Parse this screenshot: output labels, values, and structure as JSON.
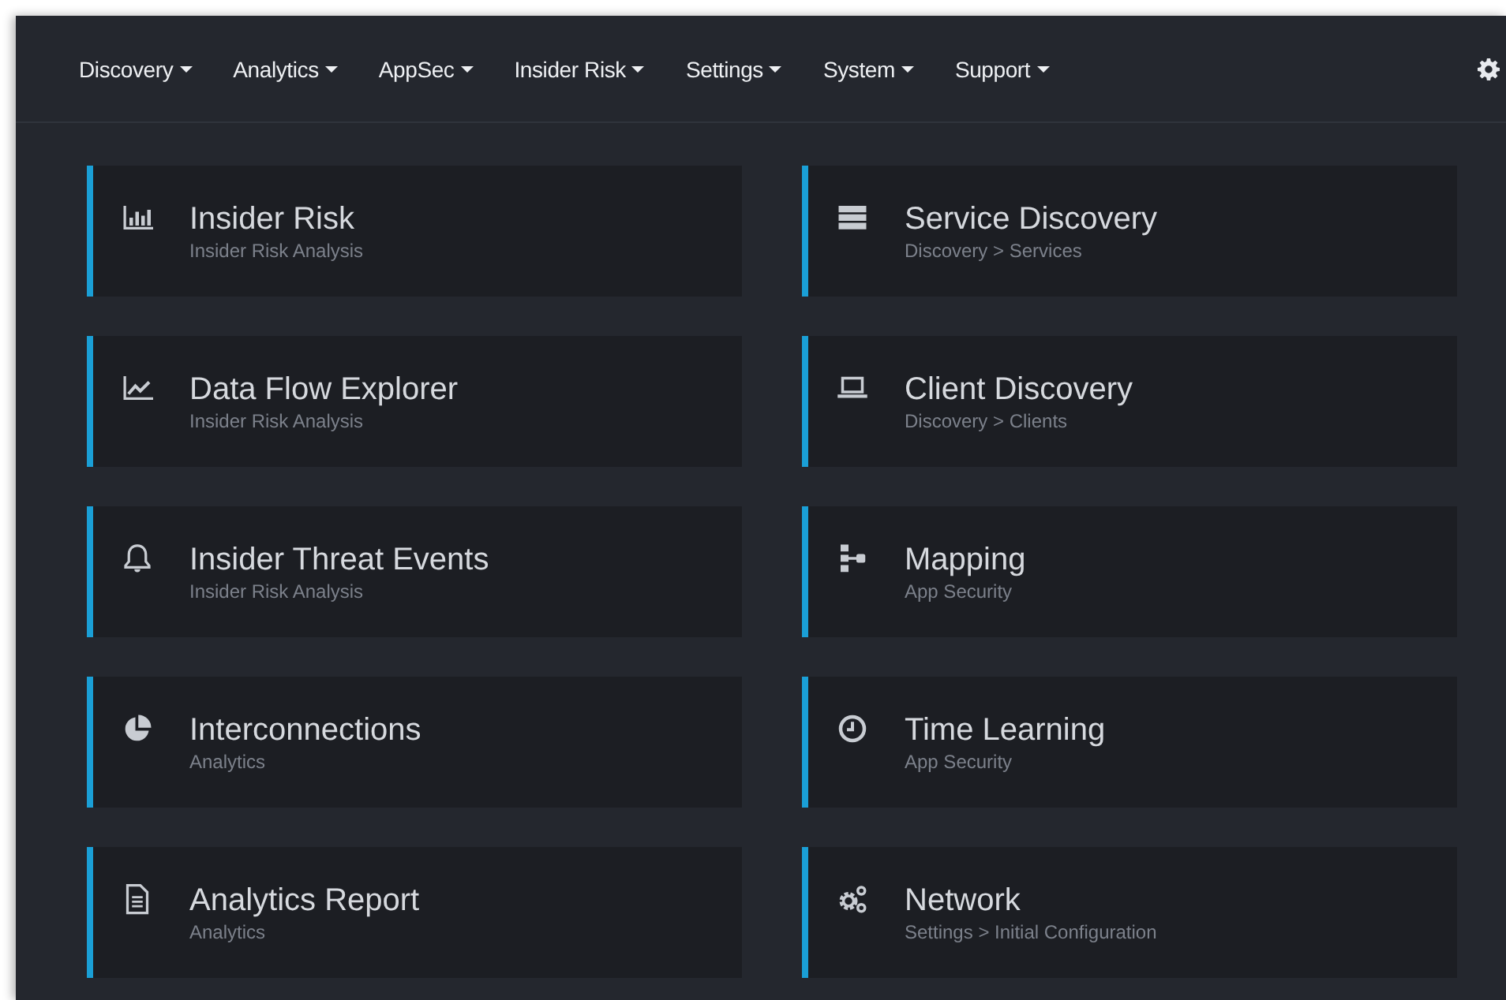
{
  "nav": {
    "menus": [
      {
        "label": "Discovery"
      },
      {
        "label": "Analytics"
      },
      {
        "label": "AppSec"
      },
      {
        "label": "Insider Risk"
      },
      {
        "label": "Settings"
      },
      {
        "label": "System"
      },
      {
        "label": "Support"
      }
    ]
  },
  "cards": [
    {
      "title": "Insider Risk",
      "subtitle": "Insider Risk Analysis"
    },
    {
      "title": "Service Discovery",
      "subtitle": "Discovery > Services"
    },
    {
      "title": "Data Flow Explorer",
      "subtitle": "Insider Risk Analysis"
    },
    {
      "title": "Client Discovery",
      "subtitle": "Discovery > Clients"
    },
    {
      "title": "Insider Threat Events",
      "subtitle": "Insider Risk Analysis"
    },
    {
      "title": "Mapping",
      "subtitle": "App Security"
    },
    {
      "title": "Interconnections",
      "subtitle": "Analytics"
    },
    {
      "title": "Time Learning",
      "subtitle": "App Security"
    },
    {
      "title": "Analytics Report",
      "subtitle": "Analytics"
    },
    {
      "title": "Network",
      "subtitle": "Settings > Initial Configuration"
    }
  ]
}
